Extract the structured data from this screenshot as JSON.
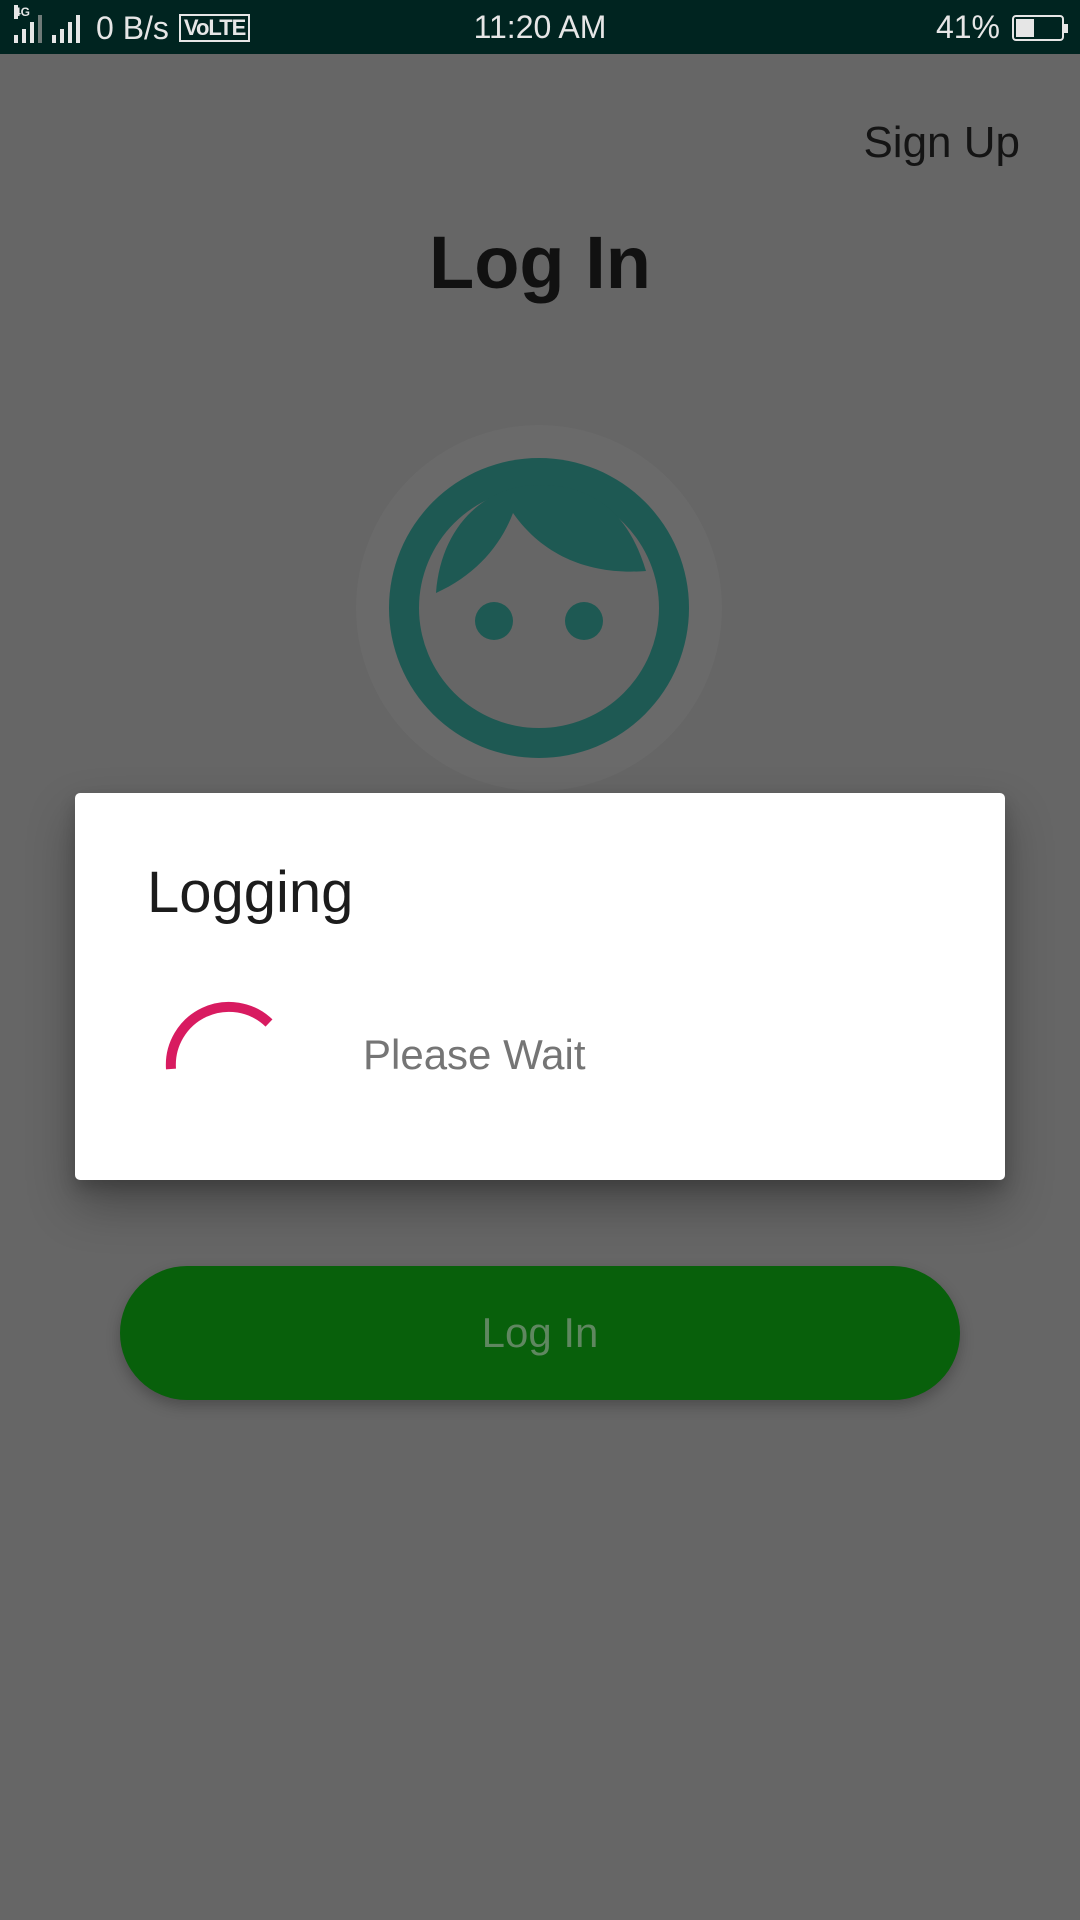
{
  "status_bar": {
    "network_type": "4G",
    "data_speed": "0 B/s",
    "volte": "VoLTE",
    "time": "11:20 AM",
    "battery_percent": "41%",
    "battery_level": 0.41
  },
  "page": {
    "signup_link": "Sign Up",
    "title": "Log In",
    "avatar_icon": "face-icon",
    "login_button_label": "Log In"
  },
  "dialog": {
    "title": "Logging",
    "message": "Please Wait",
    "spinner_icon": "progress-spinner-icon"
  },
  "colors": {
    "status_bar_bg": "#002420",
    "scrim_bg": "#666666",
    "avatar": "#1e5953",
    "login_button": "#08600b",
    "spinner": "#d81b60",
    "dialog_bg": "#ffffff"
  }
}
